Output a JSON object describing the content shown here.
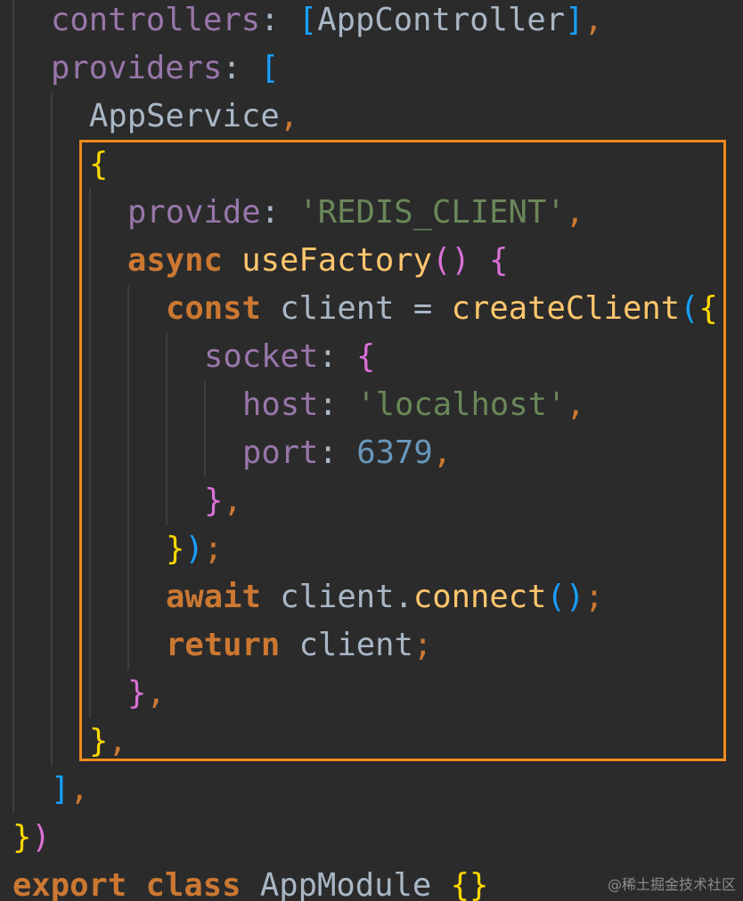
{
  "editor": {
    "background": "#2b2b2b",
    "theme": {
      "default": "#a9b7c6",
      "property": "#9876aa",
      "keyword": "#cc7832",
      "function": "#ffc66d",
      "string": "#6a8759",
      "number": "#6897bb",
      "bracket_yellow": "#ffd700",
      "bracket_pink": "#da70d6",
      "bracket_blue": "#179fff",
      "highlight_border": "#f28a1d"
    },
    "lines": [
      {
        "indent": 1,
        "tokens": [
          {
            "t": "controllers",
            "c": "property"
          },
          {
            "t": ": ",
            "c": "default"
          },
          {
            "t": "[",
            "c": "bracket_blue"
          },
          {
            "t": "AppController",
            "c": "default"
          },
          {
            "t": "]",
            "c": "bracket_blue"
          },
          {
            "t": ",",
            "c": "keyword"
          }
        ]
      },
      {
        "indent": 1,
        "tokens": [
          {
            "t": "providers",
            "c": "property"
          },
          {
            "t": ": ",
            "c": "default"
          },
          {
            "t": "[",
            "c": "bracket_blue"
          }
        ]
      },
      {
        "indent": 2,
        "tokens": [
          {
            "t": "AppService",
            "c": "default"
          },
          {
            "t": ",",
            "c": "keyword"
          }
        ]
      },
      {
        "indent": 2,
        "tokens": [
          {
            "t": "{",
            "c": "bracket_yellow"
          }
        ]
      },
      {
        "indent": 3,
        "tokens": [
          {
            "t": "provide",
            "c": "property"
          },
          {
            "t": ": ",
            "c": "default"
          },
          {
            "t": "'REDIS_CLIENT'",
            "c": "string"
          },
          {
            "t": ",",
            "c": "keyword"
          }
        ]
      },
      {
        "indent": 3,
        "tokens": [
          {
            "t": "async ",
            "c": "keyword"
          },
          {
            "t": "useFactory",
            "c": "function"
          },
          {
            "t": "() ",
            "c": "bracket_pink"
          },
          {
            "t": "{",
            "c": "bracket_pink"
          }
        ]
      },
      {
        "indent": 4,
        "tokens": [
          {
            "t": "const ",
            "c": "keyword"
          },
          {
            "t": "client ",
            "c": "default"
          },
          {
            "t": "= ",
            "c": "default"
          },
          {
            "t": "createClient",
            "c": "function"
          },
          {
            "t": "(",
            "c": "bracket_blue"
          },
          {
            "t": "{",
            "c": "bracket_yellow"
          }
        ]
      },
      {
        "indent": 5,
        "tokens": [
          {
            "t": "socket",
            "c": "property"
          },
          {
            "t": ": ",
            "c": "default"
          },
          {
            "t": "{",
            "c": "bracket_pink"
          }
        ]
      },
      {
        "indent": 6,
        "tokens": [
          {
            "t": "host",
            "c": "property"
          },
          {
            "t": ": ",
            "c": "default"
          },
          {
            "t": "'localhost'",
            "c": "string"
          },
          {
            "t": ",",
            "c": "keyword"
          }
        ]
      },
      {
        "indent": 6,
        "tokens": [
          {
            "t": "port",
            "c": "property"
          },
          {
            "t": ": ",
            "c": "default"
          },
          {
            "t": "6379",
            "c": "number"
          },
          {
            "t": ",",
            "c": "keyword"
          }
        ]
      },
      {
        "indent": 5,
        "tokens": [
          {
            "t": "}",
            "c": "bracket_pink"
          },
          {
            "t": ",",
            "c": "keyword"
          }
        ]
      },
      {
        "indent": 4,
        "tokens": [
          {
            "t": "}",
            "c": "bracket_yellow"
          },
          {
            "t": ")",
            "c": "bracket_blue"
          },
          {
            "t": ";",
            "c": "keyword"
          }
        ]
      },
      {
        "indent": 4,
        "tokens": [
          {
            "t": "await ",
            "c": "keyword"
          },
          {
            "t": "client",
            "c": "default"
          },
          {
            "t": ".",
            "c": "default"
          },
          {
            "t": "connect",
            "c": "function"
          },
          {
            "t": "()",
            "c": "bracket_blue"
          },
          {
            "t": ";",
            "c": "keyword"
          }
        ]
      },
      {
        "indent": 4,
        "tokens": [
          {
            "t": "return ",
            "c": "keyword"
          },
          {
            "t": "client",
            "c": "default"
          },
          {
            "t": ";",
            "c": "keyword"
          }
        ]
      },
      {
        "indent": 3,
        "tokens": [
          {
            "t": "}",
            "c": "bracket_pink"
          },
          {
            "t": ",",
            "c": "keyword"
          }
        ]
      },
      {
        "indent": 2,
        "tokens": [
          {
            "t": "}",
            "c": "bracket_yellow"
          },
          {
            "t": ",",
            "c": "keyword"
          }
        ]
      },
      {
        "indent": 1,
        "tokens": [
          {
            "t": "]",
            "c": "bracket_blue"
          },
          {
            "t": ",",
            "c": "keyword"
          }
        ]
      },
      {
        "indent": 0,
        "tokens": [
          {
            "t": "}",
            "c": "bracket_yellow"
          },
          {
            "t": ")",
            "c": "bracket_pink"
          }
        ]
      },
      {
        "indent": 0,
        "tokens": [
          {
            "t": "export ",
            "c": "keyword"
          },
          {
            "t": "class ",
            "c": "keyword"
          },
          {
            "t": "AppModule ",
            "c": "default"
          },
          {
            "t": "{}",
            "c": "bracket_yellow"
          }
        ]
      }
    ]
  },
  "watermark": "@稀土掘金技术社区"
}
